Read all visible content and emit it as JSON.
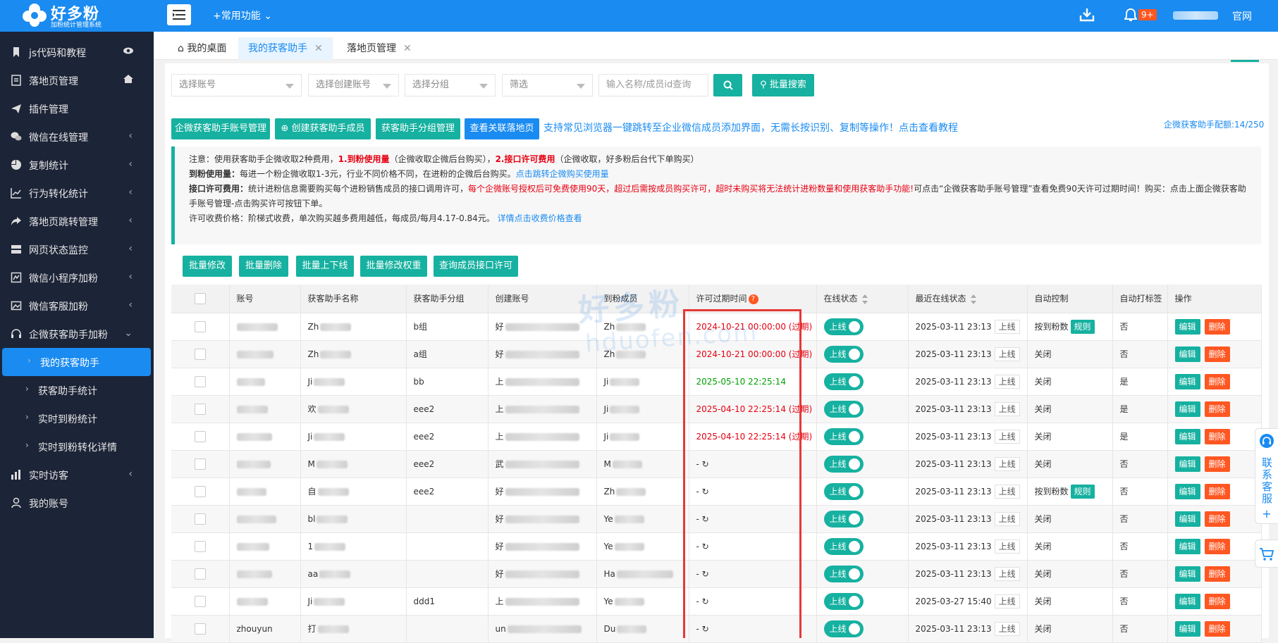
{
  "brand": {
    "name": "好多粉",
    "subtitle": "加粉统计管理系统"
  },
  "topbar": {
    "common_label": "+常用功能",
    "badge": "9+",
    "official": "官网"
  },
  "sidebar": {
    "items": [
      {
        "label": "js代码和教程",
        "icon": "bookmark-icon",
        "right": "eye-icon"
      },
      {
        "label": "落地页管理",
        "icon": "page-icon",
        "right": "home-icon"
      },
      {
        "label": "插件管理",
        "icon": "send-icon"
      },
      {
        "label": "微信在线管理",
        "icon": "wechat-icon",
        "chev": true
      },
      {
        "label": "复制统计",
        "icon": "pie-icon",
        "chev": true
      },
      {
        "label": "行为转化统计",
        "icon": "line-chart-icon",
        "chev": true
      },
      {
        "label": "落地页跳转管理",
        "icon": "share-icon",
        "chev": true
      },
      {
        "label": "网页状态监控",
        "icon": "server-icon",
        "chev": true
      },
      {
        "label": "微信小程序加粉",
        "icon": "miniapp-icon",
        "chev": true
      },
      {
        "label": "微信客服加粉",
        "icon": "image-icon",
        "chev": true
      },
      {
        "label": "企微获客助手加粉",
        "icon": "headset-icon",
        "chev": true
      }
    ],
    "sub_items": [
      {
        "label": "我的获客助手"
      },
      {
        "label": "获客助手统计"
      },
      {
        "label": "实时到粉统计"
      },
      {
        "label": "实时到粉转化详情"
      }
    ],
    "bottom_items": [
      {
        "label": "实时访客",
        "icon": "bar-icon",
        "chev": true
      },
      {
        "label": "我的账号",
        "icon": "user-icon"
      }
    ]
  },
  "tabs": [
    {
      "label": "我的桌面"
    },
    {
      "label": "我的获客助手"
    },
    {
      "label": "落地页管理"
    }
  ],
  "filters": {
    "account": "选择账号",
    "creator": "选择创建账号",
    "group": "选择分组",
    "filter": "筛选",
    "search_placeholder": "输入名称/成员id查询",
    "batch_search": "批量搜索"
  },
  "actions": {
    "b1": "企微获客助手账号管理",
    "b2": "创建获客助手成员",
    "b3": "获客助手分组管理",
    "b4": "查看关联落地页",
    "promo": "支持常见浏览器一键跳转至企业微信成员添加界面，无需长按识别、复制等操作！点击查看教程",
    "quota": "企微获客助手配额:14/250"
  },
  "notice": {
    "l1a": "注意：使用获客助手企微收取2种费用，",
    "l1b": "1.到粉使用量",
    "l1c": "（企微收取企微后台购买），",
    "l1d": "2.接口许可费用",
    "l1e": "（企微收取，好多粉后台代下单购买）",
    "l2a": "到粉使用量：",
    "l2b": "每进一个粉企微收取1-3元，行业不同价格不同，在进粉的企微后台购买。",
    "l2c": "点击跳转企微购买使用量",
    "l3a": "接口许可费用：",
    "l3b": "统计进粉信息需要购买每个进粉销售成员的接口调用许可，",
    "l3c": "每个企微账号授权后可免费使用90天，超过后需按成员购买许可，超时未购买将无法统计进粉数量和使用获客助手功能!",
    "l3d": "可点击“企微获客助手账号管理”查看免费90天许可过期时间！购买：点击上面企微获客助",
    "l4": "手账号管理-点击购买许可按钮下单。",
    "l5a": "许可收费价格：阶梯式收费，单次购买越多费用越低，每成员/每月4.17-0.84元。",
    "l5b": "详情点击收费价格查看"
  },
  "batch": {
    "b1": "批量修改",
    "b2": "批量删除",
    "b3": "批量上下线",
    "b4": "批量修改权重",
    "b5": "查询成员接口许可"
  },
  "table": {
    "headers": {
      "account": "账号",
      "name": "获客助手名称",
      "group": "获客助手分组",
      "creator": "创建账号",
      "member": "到粉成员",
      "license": "许可过期时间",
      "online": "在线状态",
      "last": "最近在线状态",
      "auto": "自动控制",
      "tag": "自动打标签",
      "ops": "操作"
    },
    "rows": [
      {
        "account": "",
        "name": "Zh",
        "group": "b组",
        "creator": "好",
        "member": "Zh",
        "license": "2024-10-21 00:00:00 (过期)",
        "ls": "red",
        "online": "上线",
        "last": "2025-03-11 23:13",
        "ltag": "上线",
        "auto": "按到粉数",
        "rule": "规则",
        "tag": "否"
      },
      {
        "account": "",
        "name": "Zh",
        "group": "a组",
        "creator": "好",
        "member": "Zh",
        "license": "2024-10-21 00:00:00 (过期)",
        "ls": "red",
        "online": "上线",
        "last": "2025-03-11 23:13",
        "ltag": "上线",
        "auto": "关闭",
        "rule": "",
        "tag": "否"
      },
      {
        "account": "",
        "name": "Ji",
        "group": "bb",
        "creator": "上",
        "member": "Ji",
        "license": "2025-05-10 22:25:14",
        "ls": "green",
        "online": "上线",
        "last": "2025-03-11 23:13",
        "ltag": "上线",
        "auto": "关闭",
        "rule": "",
        "tag": "是"
      },
      {
        "account": "",
        "name": "欢",
        "group": "eee2",
        "creator": "上",
        "member": "Ji",
        "license": "2025-04-10 22:25:14 (过期)",
        "ls": "red",
        "online": "上线",
        "last": "2025-03-11 23:13",
        "ltag": "上线",
        "auto": "关闭",
        "rule": "",
        "tag": "是"
      },
      {
        "account": "",
        "name": "Ji",
        "group": "eee2",
        "creator": "上",
        "member": "Ji",
        "license": "2025-04-10 22:25:14 (过期)",
        "ls": "red",
        "online": "上线",
        "last": "2025-03-11 23:13",
        "ltag": "上线",
        "auto": "关闭",
        "rule": "",
        "tag": "是"
      },
      {
        "account": "",
        "name": "M",
        "group": "eee2",
        "creator": "武",
        "member": "M",
        "license": "- ↻",
        "ls": "none",
        "online": "上线",
        "last": "2025-03-11 23:13",
        "ltag": "上线",
        "auto": "关闭",
        "rule": "",
        "tag": "否"
      },
      {
        "account": "",
        "name": "自",
        "group": "eee2",
        "creator": "好",
        "member": "Zh",
        "license": "- ↻",
        "ls": "none",
        "online": "上线",
        "last": "2025-03-11 23:13",
        "ltag": "上线",
        "auto": "按到粉数",
        "rule": "规则",
        "tag": "否"
      },
      {
        "account": "",
        "name": "bl",
        "group": "",
        "creator": "好",
        "member": "Ye",
        "license": "- ↻",
        "ls": "none",
        "online": "上线",
        "last": "2025-03-11 23:13",
        "ltag": "上线",
        "auto": "关闭",
        "rule": "",
        "tag": "否"
      },
      {
        "account": "",
        "name": "1",
        "group": "",
        "creator": "好",
        "member": "Ye",
        "license": "- ↻",
        "ls": "none",
        "online": "上线",
        "last": "2025-03-11 23:13",
        "ltag": "上线",
        "auto": "关闭",
        "rule": "",
        "tag": "否"
      },
      {
        "account": "",
        "name": "aa",
        "group": "",
        "creator": "好",
        "member": "Ha",
        "license": "- ↻",
        "ls": "none",
        "online": "上线",
        "last": "2025-03-11 23:13",
        "ltag": "上线",
        "auto": "关闭",
        "rule": "",
        "tag": "否"
      },
      {
        "account": "",
        "name": "Ji",
        "group": "ddd1",
        "creator": "上",
        "member": "Ye",
        "license": "- ↻",
        "ls": "none",
        "online": "上线",
        "last": "2025-03-27 15:40",
        "ltag": "上线",
        "auto": "关闭",
        "rule": "",
        "tag": "否"
      },
      {
        "account": "zhouyun",
        "name": "打",
        "group": "",
        "creator": "un",
        "member": "Du",
        "license": "- ↻",
        "ls": "none",
        "online": "上线",
        "last": "2025-03-11 23:13",
        "ltag": "上线",
        "auto": "关闭",
        "rule": "",
        "tag": "否"
      }
    ],
    "edit": "编辑",
    "delete": "删除"
  },
  "float": {
    "label": "联系客服",
    "plus": "+"
  },
  "watermark": {
    "l1": "好多粉",
    "l2": "hduofen.com"
  },
  "colors": {
    "primary": "#1a8bf0",
    "teal": "#16b1a0",
    "danger": "#ff5722",
    "sidebar": "#1c2437",
    "expired": "#e60012",
    "valid": "#00a000"
  }
}
